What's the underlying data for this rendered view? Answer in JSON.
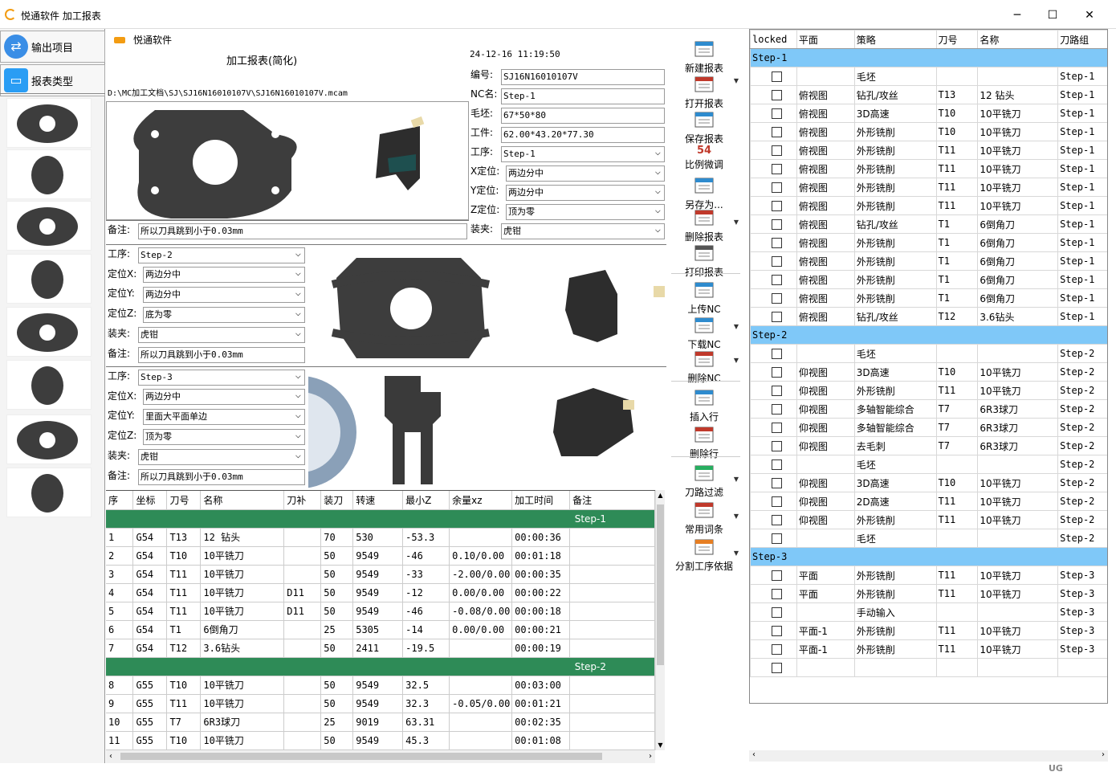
{
  "window": {
    "title": "悦通软件  加工报表",
    "minimize": "─",
    "maximize": "☐",
    "close": "✕"
  },
  "sidebar": {
    "items": [
      {
        "label": "输出项目",
        "icon": "swap-arrows-icon"
      },
      {
        "label": "报表类型",
        "icon": "wallet-icon"
      }
    ],
    "thumbnail_count": 8
  },
  "report": {
    "brand": "悦通软件",
    "title": "加工报表(简化)",
    "datetime": "24-12-16 11:19:50",
    "path": "D:\\MC加工文档\\SJ\\SJ16N16010107V\\SJ16N16010107V.mcam",
    "header_fields": [
      {
        "label": "编号:",
        "value": "SJ16N16010107V",
        "combo": false
      },
      {
        "label": "NC名:",
        "value": "Step-1",
        "combo": false
      },
      {
        "label": "毛坯:",
        "value": "67*50*80",
        "combo": false
      },
      {
        "label": "工件:",
        "value": "62.00*43.20*77.30",
        "combo": false
      },
      {
        "label": "工序:",
        "value": "Step-1",
        "combo": true
      },
      {
        "label": "X定位:",
        "value": "两边分中",
        "combo": true
      },
      {
        "label": "Y定位:",
        "value": "两边分中",
        "combo": true
      },
      {
        "label": "Z定位:",
        "value": "顶为零",
        "combo": true
      },
      {
        "label": "装夹:",
        "value": "虎钳",
        "combo": true
      }
    ],
    "note1_label": "备注:",
    "note1_value": "所以刀具跳到小于0.03mm",
    "step2": {
      "process_label": "工序:",
      "process": "Step-2",
      "x_label": "定位X:",
      "x": "两边分中",
      "y_label": "定位Y:",
      "y": "两边分中",
      "z_label": "定位Z:",
      "z": "底为零",
      "clamp_label": "装夹:",
      "clamp": "虎钳",
      "note_label": "备注:",
      "note": "所以刀具跳到小于0.03mm"
    },
    "step3": {
      "process_label": "工序:",
      "process": "Step-3",
      "x_label": "定位X:",
      "x": "两边分中",
      "y_label": "定位Y:",
      "y": "里面大平面单边",
      "z_label": "定位Z:",
      "z": "顶为零",
      "clamp_label": "装夹:",
      "clamp": "虎钳",
      "note_label": "备注:",
      "note": "所以刀具跳到小于0.03mm"
    }
  },
  "ops_table": {
    "headers": [
      "序",
      "坐标",
      "刀号",
      "名称",
      "刀补",
      "装刀",
      "转速",
      "最小Z",
      "余量xz",
      "加工时间",
      "备注"
    ],
    "groups": [
      {
        "name": "Step-1",
        "rows": [
          [
            "1",
            "G54",
            "T13",
            "12 钻头",
            "",
            "70",
            "530",
            "-53.3",
            "",
            "00:00:36",
            ""
          ],
          [
            "2",
            "G54",
            "T10",
            "10平铣刀",
            "",
            "50",
            "9549",
            "-46",
            "0.10/0.00",
            "00:01:18",
            ""
          ],
          [
            "3",
            "G54",
            "T11",
            "10平铣刀",
            "",
            "50",
            "9549",
            "-33",
            "-2.00/0.00",
            "00:00:35",
            ""
          ],
          [
            "4",
            "G54",
            "T11",
            "10平铣刀",
            "D11",
            "50",
            "9549",
            "-12",
            "0.00/0.00",
            "00:00:22",
            ""
          ],
          [
            "5",
            "G54",
            "T11",
            "10平铣刀",
            "D11",
            "50",
            "9549",
            "-46",
            "-0.08/0.00",
            "00:00:18",
            ""
          ],
          [
            "6",
            "G54",
            "T1",
            "6倒角刀",
            "",
            "25",
            "5305",
            "-14",
            "0.00/0.00",
            "00:00:21",
            ""
          ],
          [
            "7",
            "G54",
            "T12",
            "3.6钻头",
            "",
            "50",
            "2411",
            "-19.5",
            "",
            "00:00:19",
            ""
          ]
        ]
      },
      {
        "name": "Step-2",
        "rows": [
          [
            "8",
            "G55",
            "T10",
            "10平铣刀",
            "",
            "50",
            "9549",
            "32.5",
            "",
            "00:03:00",
            ""
          ],
          [
            "9",
            "G55",
            "T11",
            "10平铣刀",
            "",
            "50",
            "9549",
            "32.3",
            "-0.05/0.00",
            "00:01:21",
            ""
          ],
          [
            "10",
            "G55",
            "T7",
            "6R3球刀",
            "",
            "25",
            "9019",
            "63.31",
            "",
            "00:02:35",
            ""
          ],
          [
            "11",
            "G55",
            "T10",
            "10平铣刀",
            "",
            "50",
            "9549",
            "45.3",
            "",
            "00:01:08",
            ""
          ]
        ]
      }
    ]
  },
  "toolbar": {
    "buttons": [
      {
        "label": "新建报表",
        "icon": "new-report-icon"
      },
      {
        "label": "打开报表",
        "icon": "open-report-icon"
      },
      {
        "label": "保存报表",
        "icon": "save-report-icon"
      },
      {
        "label": "比例微调",
        "icon": "scale-adjust-icon",
        "glyph": "54"
      },
      {
        "label": "另存为...",
        "icon": "save-as-icon"
      },
      {
        "label": "删除报表",
        "icon": "delete-report-icon"
      },
      {
        "label": "打印报表",
        "icon": "print-icon"
      },
      {
        "label": "上传NC",
        "icon": "upload-nc-icon"
      },
      {
        "label": "下载NC",
        "icon": "download-nc-icon"
      },
      {
        "label": "删除NC",
        "icon": "delete-nc-icon"
      },
      {
        "label": "插入行",
        "icon": "insert-row-icon"
      },
      {
        "label": "删除行",
        "icon": "delete-row-icon"
      },
      {
        "label": "刀路过滤",
        "icon": "filter-icon"
      },
      {
        "label": "常用词条",
        "icon": "phrases-icon"
      },
      {
        "label": "分割工序依据",
        "icon": "split-process-icon"
      }
    ]
  },
  "right_table": {
    "headers": [
      "locked",
      "平面",
      "策略",
      "刀号",
      "名称",
      "刀路组"
    ],
    "groups": [
      {
        "name": "Step-1",
        "rows": [
          [
            "",
            "",
            "毛坯",
            "",
            "",
            "Step-1"
          ],
          [
            "",
            "俯视图",
            "钻孔/攻丝",
            "T13",
            "12 钻头",
            "Step-1"
          ],
          [
            "",
            "俯视图",
            "3D高速",
            "T10",
            "10平铣刀",
            "Step-1"
          ],
          [
            "",
            "俯视图",
            "外形铣削",
            "T10",
            "10平铣刀",
            "Step-1"
          ],
          [
            "",
            "俯视图",
            "外形铣削",
            "T11",
            "10平铣刀",
            "Step-1"
          ],
          [
            "",
            "俯视图",
            "外形铣削",
            "T11",
            "10平铣刀",
            "Step-1"
          ],
          [
            "",
            "俯视图",
            "外形铣削",
            "T11",
            "10平铣刀",
            "Step-1"
          ],
          [
            "",
            "俯视图",
            "外形铣削",
            "T11",
            "10平铣刀",
            "Step-1"
          ],
          [
            "",
            "俯视图",
            "钻孔/攻丝",
            "T1",
            "6倒角刀",
            "Step-1"
          ],
          [
            "",
            "俯视图",
            "外形铣削",
            "T1",
            "6倒角刀",
            "Step-1"
          ],
          [
            "",
            "俯视图",
            "外形铣削",
            "T1",
            "6倒角刀",
            "Step-1"
          ],
          [
            "",
            "俯视图",
            "外形铣削",
            "T1",
            "6倒角刀",
            "Step-1"
          ],
          [
            "",
            "俯视图",
            "外形铣削",
            "T1",
            "6倒角刀",
            "Step-1"
          ],
          [
            "",
            "俯视图",
            "钻孔/攻丝",
            "T12",
            "3.6钻头",
            "Step-1"
          ]
        ]
      },
      {
        "name": "Step-2",
        "rows": [
          [
            "",
            "",
            "毛坯",
            "",
            "",
            "Step-2"
          ],
          [
            "",
            "仰视图",
            "3D高速",
            "T10",
            "10平铣刀",
            "Step-2"
          ],
          [
            "",
            "仰视图",
            "外形铣削",
            "T11",
            "10平铣刀",
            "Step-2"
          ],
          [
            "",
            "仰视图",
            "多轴智能综合",
            "T7",
            "6R3球刀",
            "Step-2"
          ],
          [
            "",
            "仰视图",
            "多轴智能综合",
            "T7",
            "6R3球刀",
            "Step-2"
          ],
          [
            "",
            "仰视图",
            "去毛刺",
            "T7",
            "6R3球刀",
            "Step-2"
          ],
          [
            "",
            "",
            "毛坯",
            "",
            "",
            "Step-2"
          ],
          [
            "",
            "仰视图",
            "3D高速",
            "T10",
            "10平铣刀",
            "Step-2"
          ],
          [
            "",
            "仰视图",
            "2D高速",
            "T11",
            "10平铣刀",
            "Step-2"
          ],
          [
            "",
            "仰视图",
            "外形铣削",
            "T11",
            "10平铣刀",
            "Step-2"
          ],
          [
            "",
            "",
            "毛坯",
            "",
            "",
            "Step-2"
          ]
        ]
      },
      {
        "name": "Step-3",
        "rows": [
          [
            "",
            "平面",
            "外形铣削",
            "T11",
            "10平铣刀",
            "Step-3"
          ],
          [
            "",
            "平面",
            "外形铣削",
            "T11",
            "10平铣刀",
            "Step-3"
          ],
          [
            "",
            "",
            "手动输入",
            "",
            "",
            "Step-3"
          ],
          [
            "",
            "平面-1",
            "外形铣削",
            "T11",
            "10平铣刀",
            "Step-3"
          ],
          [
            "",
            "平面-1",
            "外形铣削",
            "T11",
            "10平铣刀",
            "Step-3"
          ],
          [
            "",
            "",
            "",
            "",
            "",
            ""
          ]
        ]
      }
    ]
  },
  "statusbar": {
    "corner_text": "UG"
  },
  "colors": {
    "step_green": "#2e8b57",
    "step_blue": "#7fc8f8",
    "part_dark": "#3a3a3a"
  }
}
